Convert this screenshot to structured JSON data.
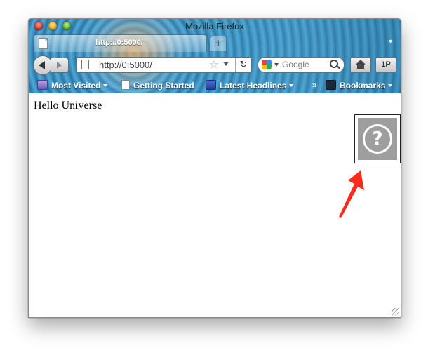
{
  "window": {
    "title": "Mozilla Firefox"
  },
  "tabs": [
    {
      "label": "http://0:5000/"
    }
  ],
  "newtab": {
    "label": "+"
  },
  "navbar": {
    "url": "http://0:5000/",
    "search_placeholder": "Google",
    "onep_label": "1P"
  },
  "bookmarks": {
    "items": [
      {
        "label": "Most Visited"
      },
      {
        "label": "Getting Started"
      },
      {
        "label": "Latest Headlines"
      }
    ],
    "overflow": "»",
    "menu_label": "Bookmarks"
  },
  "content": {
    "text": "Hello Universe",
    "help_glyph": "?"
  },
  "colors": {
    "arrow": "#ff2a1a",
    "help_bg": "#9e9e9e"
  }
}
